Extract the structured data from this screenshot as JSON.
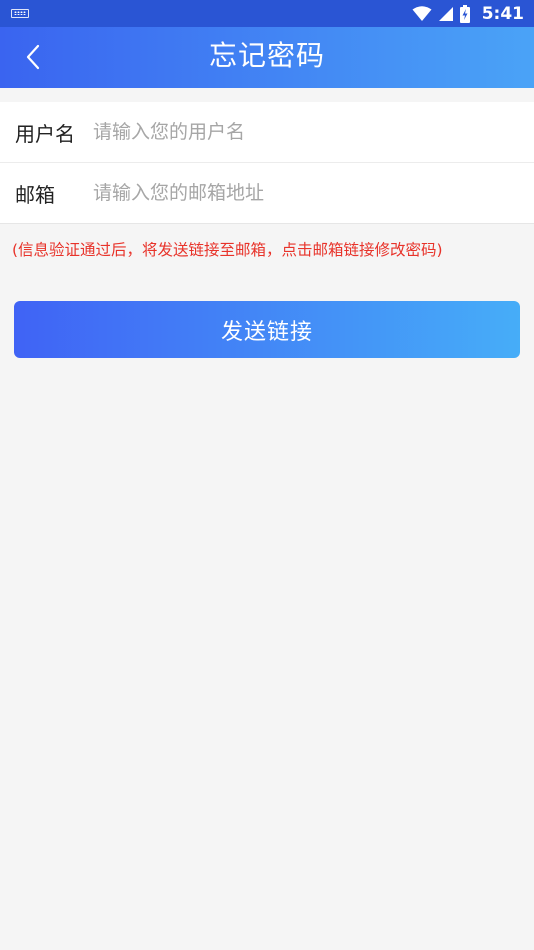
{
  "status_bar": {
    "time": "5:41",
    "icons": [
      "keyboard-icon",
      "wifi-icon",
      "signal-icon",
      "battery-charging-icon"
    ]
  },
  "header": {
    "title": "忘记密码",
    "back_icon": "chevron-left-icon"
  },
  "form": {
    "username": {
      "label": "用户名",
      "placeholder": "请输入您的用户名",
      "value": ""
    },
    "email": {
      "label": "邮箱",
      "placeholder": "请输入您的邮箱地址",
      "value": ""
    }
  },
  "notice": "(信息验证通过后，将发送链接至邮箱，点击邮箱链接修改密码)",
  "submit_label": "发送链接",
  "colors": {
    "header_start": "#3a64f0",
    "header_end": "#4aa3f7",
    "notice": "#e8332a",
    "background": "#f5f5f5"
  }
}
